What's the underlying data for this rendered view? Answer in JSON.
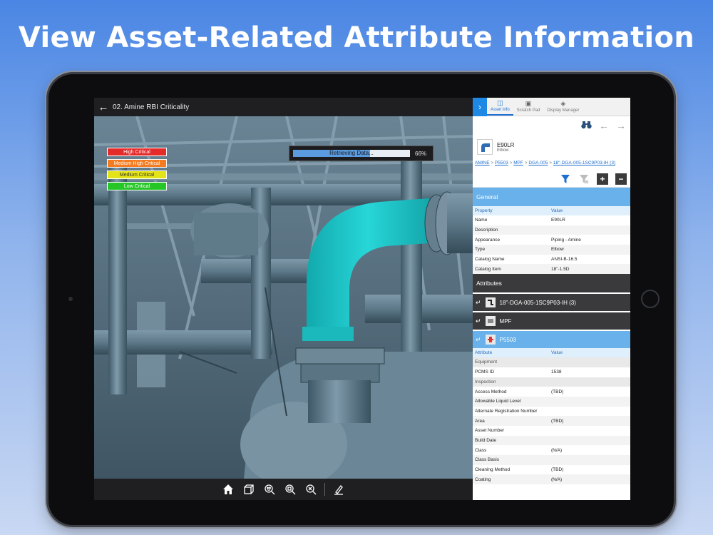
{
  "headline": "View Asset-Related Attribute Information",
  "viewport": {
    "title": "02. Amine RBI Criticality",
    "legend": [
      {
        "label": "High Critical",
        "color": "#e52a2a"
      },
      {
        "label": "Medium High Critical",
        "color": "#f47b20"
      },
      {
        "label": "Medium Critical",
        "color": "#e3e317"
      },
      {
        "label": "Low Critical",
        "color": "#27c627"
      }
    ],
    "progress": {
      "label": "Retrieving Data...",
      "percent_text": "66%",
      "fraction": 0.66
    },
    "toolbar": [
      "home-icon",
      "cube-icon",
      "zoom-fit-icon",
      "zoom-extents-icon",
      "zoom-window-icon",
      "markup-pen-icon"
    ]
  },
  "panel": {
    "tabs": [
      {
        "label": "Asset Info",
        "active": true
      },
      {
        "label": "Scratch Pad",
        "active": false
      },
      {
        "label": "Display Manager",
        "active": false
      }
    ],
    "asset": {
      "name": "E90LR",
      "type": "Elbow"
    },
    "breadcrumb": [
      "AMINE",
      "P5503",
      "MPF",
      "DGA-005",
      "18\"-DGA-005-1SC9P03-IH (3)"
    ],
    "general": {
      "title": "General",
      "header": [
        "Property",
        "Value"
      ],
      "rows": [
        [
          "Name",
          "E90LR"
        ],
        [
          "Description",
          ""
        ],
        [
          "Appearance",
          "Piping - Amine"
        ],
        [
          "Type",
          "Elbow"
        ],
        [
          "Catalog Name",
          "ANSI-B-16.5"
        ],
        [
          "Catalog Item",
          "18\"-1.5D"
        ]
      ]
    },
    "attributes_title": "Attributes",
    "attribute_items": [
      {
        "label": "18\"-DGA-005-1SC9P03-IH (3)",
        "highlight": false
      },
      {
        "label": "MPF",
        "highlight": false
      },
      {
        "label": "P5503",
        "highlight": true
      }
    ],
    "detail": {
      "header": [
        "Attribute",
        "Value"
      ],
      "groups": [
        {
          "name": "Equipment",
          "rows": [
            [
              "PCMS ID",
              "1538"
            ]
          ]
        },
        {
          "name": "Inspection",
          "rows": [
            [
              "Access Method",
              "(TBD)"
            ],
            [
              "Allowable Liquid Level",
              ""
            ],
            [
              "Alternate Registration Number",
              ""
            ],
            [
              "Area",
              "(TBD)"
            ],
            [
              "Asset Number",
              ""
            ],
            [
              "Build Date",
              ""
            ],
            [
              "Class",
              "(N/A)"
            ],
            [
              "Class Basis",
              ""
            ],
            [
              "Cleaning Method",
              "(TBD)"
            ],
            [
              "Coating",
              "(N/A)"
            ]
          ]
        }
      ]
    }
  },
  "colors": {
    "accent_blue": "#1e88e5",
    "section_blue": "#68b1ea",
    "pipe_highlight": "#1ec6c9",
    "pipe_gray": "#5f7a89"
  }
}
